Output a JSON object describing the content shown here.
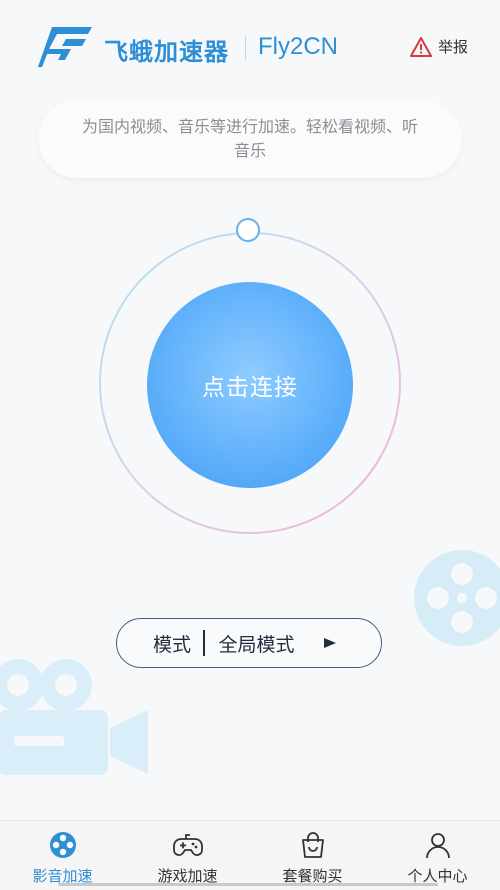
{
  "header": {
    "app_name": "飞蛾加速器",
    "app_sub": "Fly2CN",
    "report_label": "举报",
    "brand_color": "#2d8fd6",
    "logo_icon": "fly-logo-icon",
    "report_icon": "warning-triangle-icon"
  },
  "tagline": "为国内视频、音乐等进行加速。轻松看视频、听音乐",
  "connect": {
    "label": "点击连接",
    "color": "#62b2fb"
  },
  "mode": {
    "label": "模式",
    "value": "全局模式",
    "arrow_icon": "play-arrow-icon"
  },
  "tabs": [
    {
      "label": "影音加速",
      "icon": "film-reel-icon",
      "active": true
    },
    {
      "label": "游戏加速",
      "icon": "gamepad-icon",
      "active": false
    },
    {
      "label": "套餐购买",
      "icon": "shopping-bag-icon",
      "active": false
    },
    {
      "label": "个人中心",
      "icon": "user-icon",
      "active": false
    }
  ]
}
